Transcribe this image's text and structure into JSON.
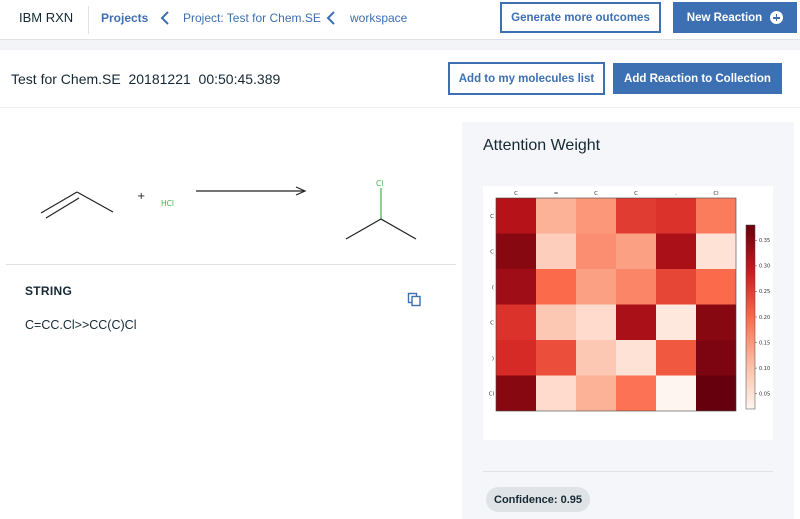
{
  "header": {
    "brand": "IBM RXN",
    "breadcrumbs": [
      "Projects",
      "Project: Test for Chem.SE",
      "workspace"
    ],
    "generate_label": "Generate more outcomes",
    "new_reaction_label": "New Reaction"
  },
  "reaction": {
    "title": "Test for Chem.SE  20181221  00:50:45.389",
    "add_molecules_label": "Add to my molecules list",
    "add_collection_label": "Add Reaction to Collection",
    "plus_sign": "+",
    "reagent_label": "HCl",
    "product_atom_label": "Cl",
    "string_label": "STRING",
    "string_value": "C=CC.Cl>>CC(C)Cl"
  },
  "attention": {
    "title": "Attention Weight",
    "confidence": "Confidence: 0.95"
  },
  "chart_data": {
    "type": "heatmap",
    "title": "",
    "x_labels": [
      "C",
      "=",
      "C",
      "C",
      ".",
      "Cl"
    ],
    "y_labels": [
      "C",
      "C",
      "(",
      "C",
      ")",
      "Cl"
    ],
    "values": [
      [
        0.31,
        0.12,
        0.15,
        0.25,
        0.26,
        0.18
      ],
      [
        0.35,
        0.08,
        0.16,
        0.14,
        0.32,
        0.05
      ],
      [
        0.33,
        0.2,
        0.14,
        0.17,
        0.24,
        0.2
      ],
      [
        0.26,
        0.09,
        0.06,
        0.32,
        0.04,
        0.35
      ],
      [
        0.27,
        0.23,
        0.09,
        0.05,
        0.22,
        0.36
      ],
      [
        0.35,
        0.06,
        0.12,
        0.19,
        0.02,
        0.38
      ]
    ],
    "colorbar_ticks": [
      0.05,
      0.1,
      0.15,
      0.2,
      0.25,
      0.3,
      0.35
    ],
    "vmin": 0.02,
    "vmax": 0.38,
    "colormap": "Reds",
    "grid": false
  },
  "colors": {
    "accent": "#3d70b2",
    "chlorine": "#3ab54a",
    "bond": "#222222"
  }
}
